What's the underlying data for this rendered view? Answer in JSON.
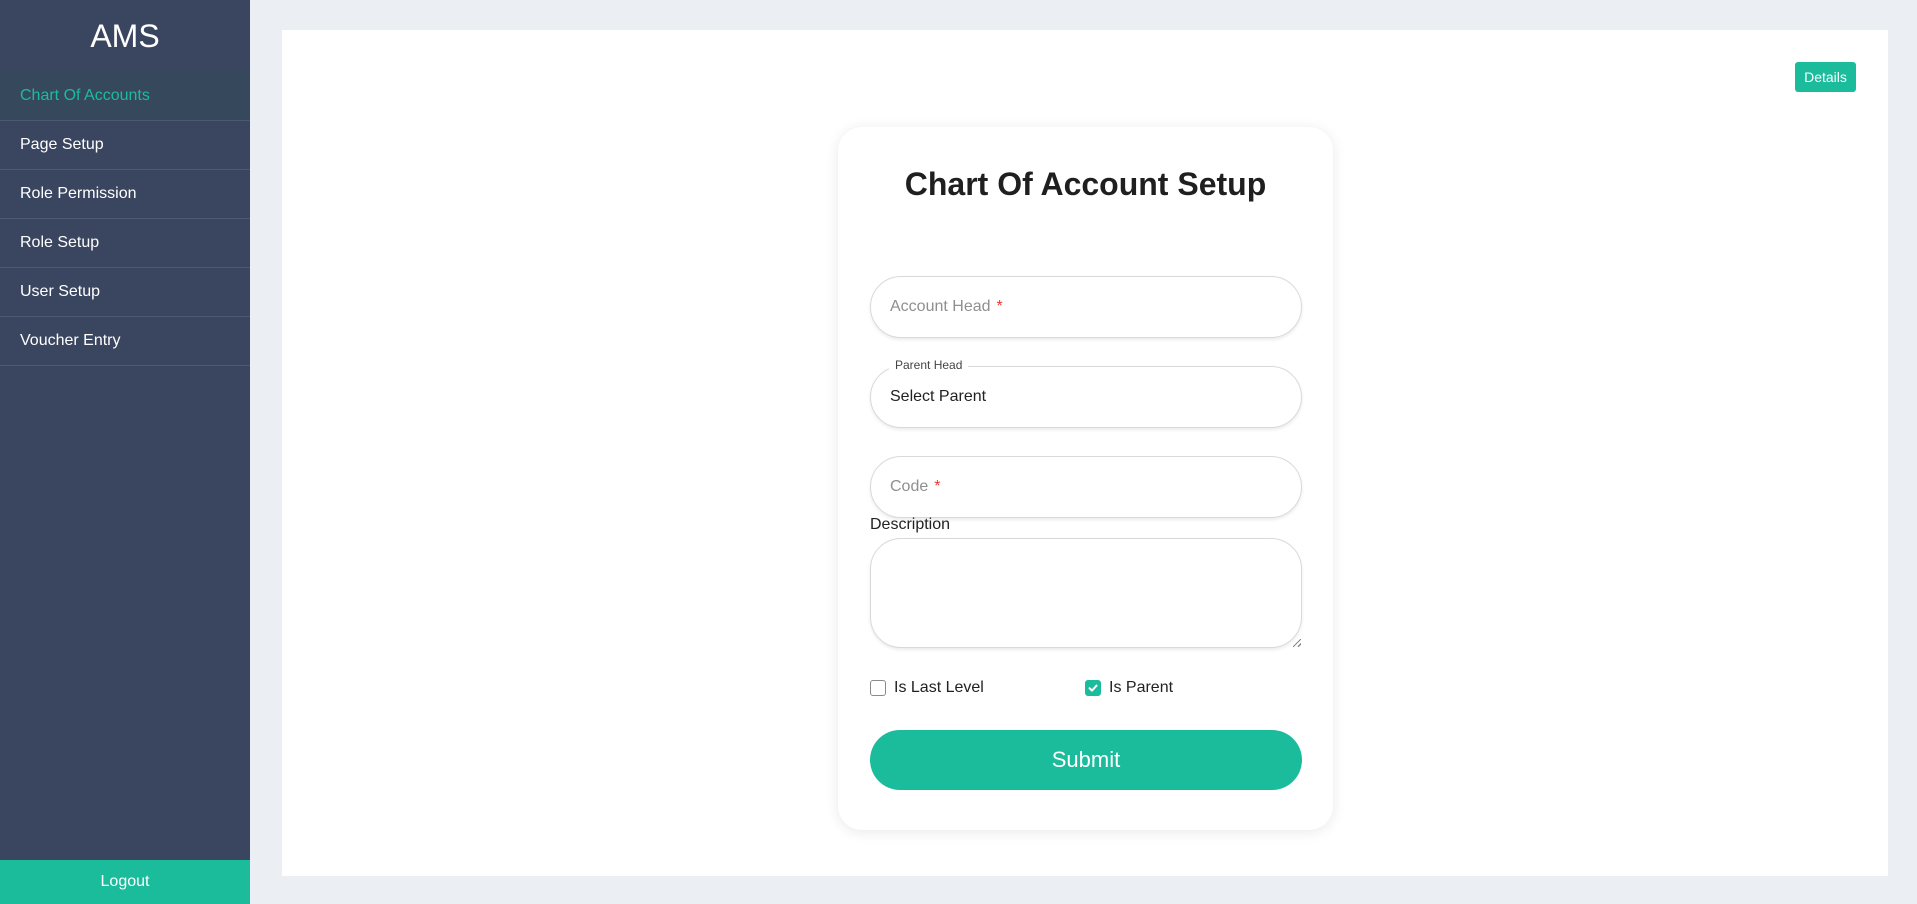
{
  "sidebar": {
    "brand": "AMS",
    "items": [
      {
        "label": "Chart Of Accounts",
        "active": true
      },
      {
        "label": "Page Setup"
      },
      {
        "label": "Role Permission"
      },
      {
        "label": "Role Setup"
      },
      {
        "label": "User Setup"
      },
      {
        "label": "Voucher Entry"
      }
    ],
    "logout": "Logout"
  },
  "header": {
    "details_label": "Details"
  },
  "form": {
    "title": "Chart Of Account Setup",
    "account_head_placeholder": "Account Head",
    "required_marker": "*",
    "parent_head_label": "Parent Head",
    "parent_head_value": "Select Parent",
    "code_placeholder": "Code",
    "description_label": "Description",
    "description_value": "",
    "is_last_level_label": "Is Last Level",
    "is_last_level_checked": false,
    "is_parent_label": "Is Parent",
    "is_parent_checked": true,
    "submit_label": "Submit"
  },
  "colors": {
    "accent": "#1abc9c",
    "sidebar_bg": "#3a4560",
    "required": "#e53935"
  }
}
